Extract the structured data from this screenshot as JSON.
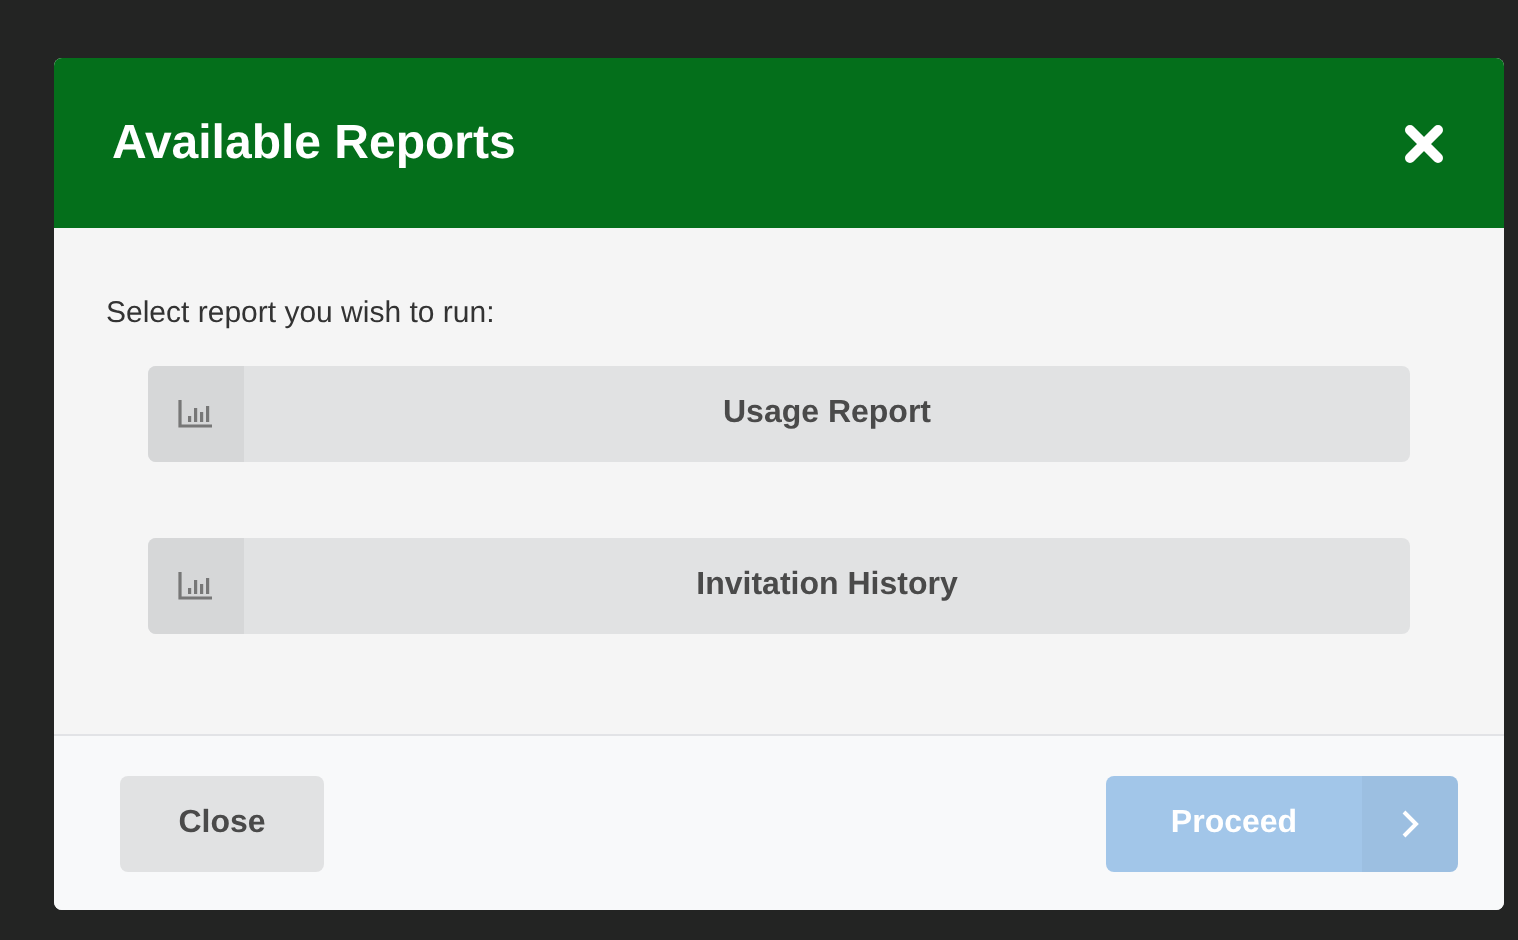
{
  "dialog": {
    "title": "Available Reports",
    "prompt": "Select report you wish to run:",
    "reports": [
      {
        "label": "Usage Report"
      },
      {
        "label": "Invitation History"
      }
    ],
    "footer": {
      "close_label": "Close",
      "proceed_label": "Proceed",
      "proceed_disabled": true
    }
  }
}
